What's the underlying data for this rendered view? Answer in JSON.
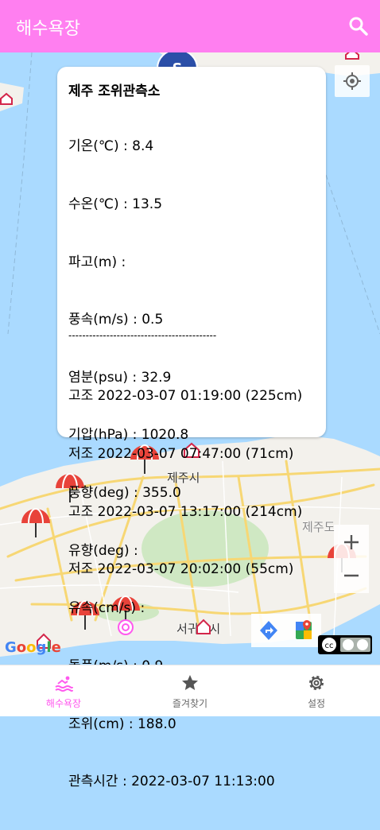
{
  "app": {
    "title": "해수욕장"
  },
  "station": {
    "name": "제주 조위관측소",
    "rows": [
      "기온(℃) : 8.4",
      "수온(℃) : 13.5",
      "파고(m) :",
      "풍속(m/s) : 0.5",
      "염분(psu) : 32.9",
      "기압(hPa) : 1020.8",
      "풍향(deg) : 355.0",
      "유향(deg) :",
      "유속(cm/s) :",
      "돌풍(m/s) : 0.9",
      "조위(cm) : 188.0",
      "관측시간 : 2022-03-07 11:13:00"
    ],
    "separator": "-------------------------------------------",
    "tides": [
      "고조 2022-03-07 01:19:00 (225cm)",
      "저조 2022-03-07 07:47:00 (71cm)",
      "고조 2022-03-07 13:17:00 (214cm)",
      "저조 2022-03-07 20:02:00 (55cm)"
    ]
  },
  "map": {
    "labels": {
      "jeju_city": "제주시",
      "jeju_do": "제주도",
      "seogwipo": "서귀포시",
      "google": "Google",
      "marker_s": "S"
    }
  },
  "nav": {
    "tabs": [
      {
        "label": "해수욕장",
        "icon": "swimmer-icon",
        "active": true
      },
      {
        "label": "즐겨찾기",
        "icon": "star-icon",
        "active": false
      },
      {
        "label": "설정",
        "icon": "gear-icon",
        "active": false
      }
    ]
  },
  "colors": {
    "accent": "#ff7ff0",
    "active_tab": "#ff59ee",
    "sea": "#aadaff",
    "land": "#f3f1ec",
    "umbrella": "#e8433a"
  }
}
